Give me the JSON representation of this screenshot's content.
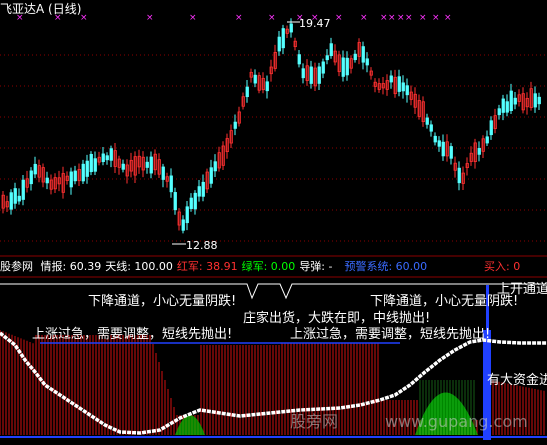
{
  "header": {
    "stock_name": "飞亚达A",
    "period": "(日线)"
  },
  "price_panel": {
    "high_label": "19.47",
    "low_label": "12.88"
  },
  "indicator_bar": {
    "source": "股参网",
    "items": [
      {
        "label": "情报:",
        "value": "60.39",
        "color": "#ffffff"
      },
      {
        "label": "天线:",
        "value": "100.00",
        "color": "#ffffff"
      },
      {
        "label": "红军:",
        "value": "38.91",
        "color": "#ff3030"
      },
      {
        "label": "绿军:",
        "value": "0.00",
        "color": "#00ff00"
      },
      {
        "label": "导弹:",
        "value": "-",
        "color": "#ffffff"
      },
      {
        "label": "预警系统:",
        "value": "60.00",
        "color": "#3a6bff"
      },
      {
        "label": "买入:",
        "value": "0",
        "color": "#ff3030"
      }
    ]
  },
  "annotations": {
    "warn_down_left": "下降通道，小心无量阴跌!",
    "warn_down_right": "下降通道，小心无量阴跌!",
    "up_open": "上开通道",
    "rise_fast_left": "上涨过急，需要调整，短线先抛出!",
    "rise_fast_right": "上涨过急，需要调整，短线先抛出!",
    "dealer_ship": "庄家出货，大跌在即，中线抛出!",
    "big_fund": "有大资金进"
  },
  "watermark": {
    "text_cn": "股旁网",
    "text_url": "www.gupang.com"
  },
  "colors": {
    "up_candle": "#ff3030",
    "down_candle": "#54ffff",
    "mark": "#ff33ff",
    "grid": "#8b0000",
    "red_bars": "#d01010",
    "green_fill": "#00c000",
    "blue_signal": "#2040ff"
  }
}
